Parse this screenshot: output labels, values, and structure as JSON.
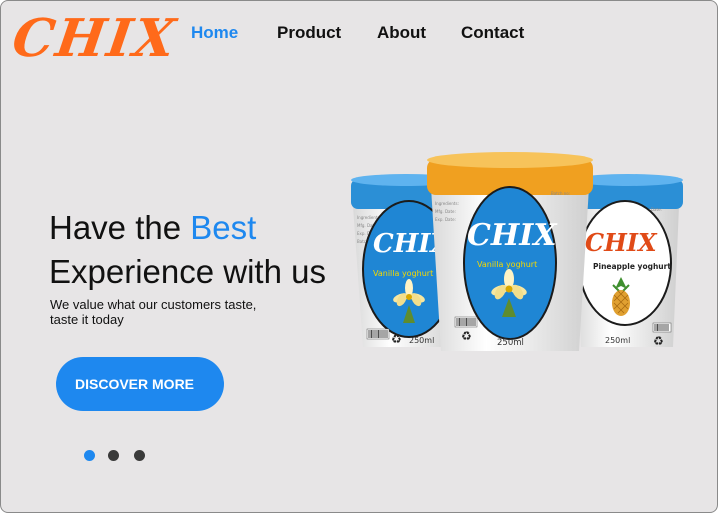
{
  "brand": {
    "logo_text": "CHIX",
    "logo_color": "#ff6a1a"
  },
  "nav": {
    "items": [
      {
        "label": "Home",
        "active": true
      },
      {
        "label": "Product",
        "active": false
      },
      {
        "label": "About",
        "active": false
      },
      {
        "label": "Contact",
        "active": false
      }
    ]
  },
  "hero": {
    "headline_part1": "Have the",
    "headline_accent": "Best",
    "headline_line2": "Experience with us",
    "subtext": "We value what our customers taste, taste it today",
    "cta_label": "DISCOVER MORE",
    "accent_color": "#1e88ef"
  },
  "carousel": {
    "total": 3,
    "active_index": 0
  },
  "product": {
    "cups": [
      {
        "brand": "CHIX",
        "flavor": "Vanilla yoghurt",
        "volume": "250ml",
        "lid_color": "#2b8fd6",
        "label_color": "#1f86d4",
        "fruit_icon": "vanilla-flower-icon"
      },
      {
        "brand": "CHIX",
        "flavor": "Vanilla yoghurt",
        "volume": "250ml",
        "lid_color": "#f0a020",
        "label_color": "#1f86d4",
        "fruit_icon": "vanilla-flower-icon"
      },
      {
        "brand": "CHIX",
        "flavor": "Pineapple yoghurt",
        "volume": "250ml",
        "lid_color": "#2b8fd6",
        "label_color": "#ffffff",
        "fruit_icon": "pineapple-icon"
      }
    ]
  }
}
